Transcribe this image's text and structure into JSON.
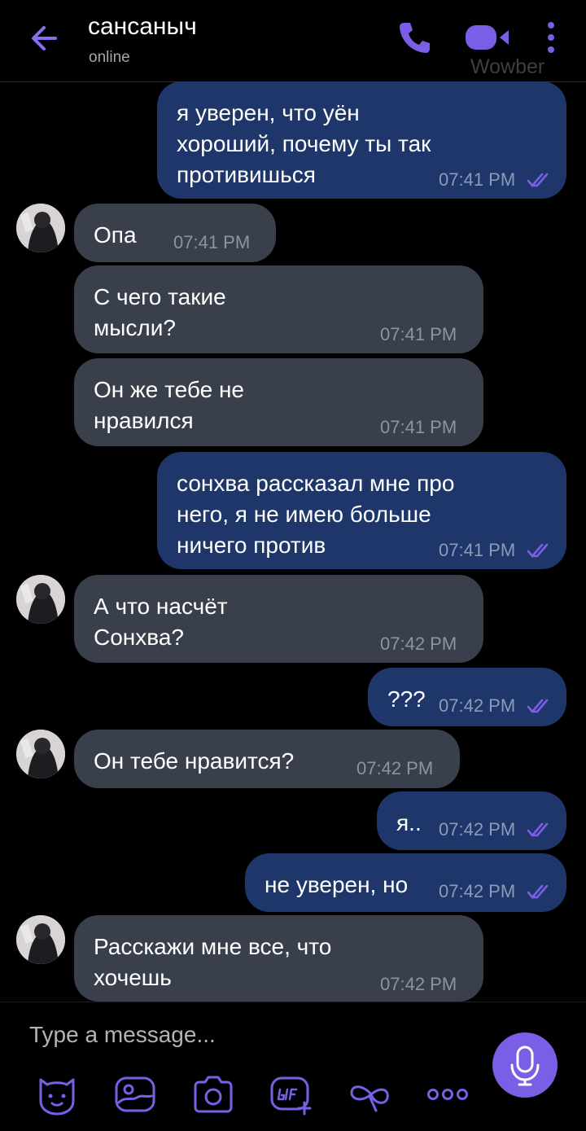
{
  "header": {
    "contact_name": "сансаныч",
    "status": "online",
    "watermark": "Wowber"
  },
  "colors": {
    "accent": "#7a5fe6",
    "outgoing_bubble": "#1e3669",
    "incoming_bubble": "#3a3f4c",
    "background": "#000000"
  },
  "messages": [
    {
      "direction": "out",
      "text": "я уверен, что уён\nхороший, почему ты так\nпротивишься",
      "time": "07:41 PM",
      "read": true
    },
    {
      "direction": "in",
      "text": "Опа",
      "time": "07:41 PM"
    },
    {
      "direction": "in",
      "text": "С чего такие\nмысли?",
      "time": "07:41 PM"
    },
    {
      "direction": "in",
      "text": "Он же тебе не\nнравился",
      "time": "07:41 PM"
    },
    {
      "direction": "out",
      "text": "сонхва рассказал мне про\nнего, я не имею больше\nничего против",
      "time": "07:41 PM",
      "read": true
    },
    {
      "direction": "in",
      "text": "А что насчёт\nСонхва?",
      "time": "07:42 PM"
    },
    {
      "direction": "out",
      "text": "???",
      "time": "07:42 PM",
      "read": true
    },
    {
      "direction": "in",
      "text": "Он тебе нравится?",
      "time": "07:42 PM"
    },
    {
      "direction": "out",
      "text": "я..",
      "time": "07:42 PM",
      "read": true
    },
    {
      "direction": "out",
      "text": "не уверен, но",
      "time": "07:42 PM",
      "read": true
    },
    {
      "direction": "in",
      "text": "Расскажи мне все, что\nхочешь",
      "time": "07:42 PM"
    }
  ],
  "composer": {
    "placeholder": "Type a message...",
    "tools": [
      "sticker-icon",
      "doodle-icon",
      "camera-icon",
      "gif-icon",
      "more-options-icon",
      "more-icon"
    ]
  }
}
